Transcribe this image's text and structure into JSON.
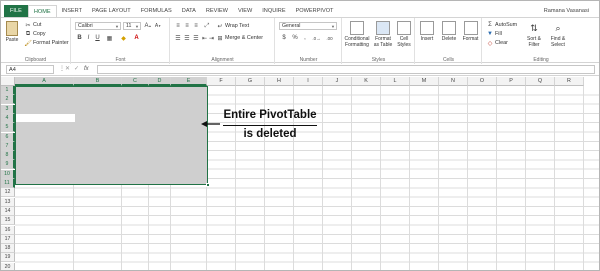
{
  "menu": {
    "tabs": [
      "FILE",
      "HOME",
      "INSERT",
      "PAGE LAYOUT",
      "FORMULAS",
      "DATA",
      "REVIEW",
      "VIEW",
      "INQUIRE",
      "POWERPIVOT"
    ],
    "user": "Ramana Vasanasi"
  },
  "ribbon": {
    "clipboard": {
      "paste": "Paste",
      "cut": "Cut",
      "copy": "Copy",
      "format_painter": "Format Painter",
      "label": "Clipboard"
    },
    "font": {
      "name": "Calibri",
      "size": "11",
      "label": "Font"
    },
    "alignment": {
      "wrap": "Wrap Text",
      "merge": "Merge & Center",
      "label": "Alignment"
    },
    "number": {
      "format": "General",
      "label": "Number"
    },
    "styles": {
      "conditional": "Conditional Formatting",
      "format_as_table": "Format as Table",
      "cell_styles": "Cell Styles",
      "label": "Styles"
    },
    "cells": {
      "insert": "Insert",
      "delete": "Delete",
      "format": "Format",
      "label": "Cells"
    },
    "editing": {
      "autosum": "AutoSum",
      "fill": "Fill",
      "clear": "Clear",
      "sort": "Sort & Filter",
      "find": "Find & Select",
      "label": "Editing"
    }
  },
  "formula_bar": {
    "name_box": "A4",
    "fx": "fx"
  },
  "grid": {
    "columns": [
      "A",
      "B",
      "C",
      "D",
      "E",
      "F",
      "G",
      "H",
      "I",
      "J",
      "K",
      "L",
      "M",
      "N",
      "O",
      "P",
      "Q",
      "R"
    ],
    "selected_columns": [
      "A",
      "B",
      "C",
      "D",
      "E"
    ],
    "rows": [
      "1",
      "2",
      "3",
      "4",
      "5",
      "6",
      "7",
      "8",
      "9",
      "10",
      "11",
      "12",
      "13",
      "14",
      "15",
      "16",
      "17",
      "18",
      "19",
      "20"
    ],
    "selected_rows": [
      "1",
      "2",
      "3",
      "4",
      "5",
      "6",
      "7",
      "8",
      "9",
      "10",
      "11"
    ]
  },
  "annotation": {
    "line1": "Entire PivotTable",
    "line2": "is deleted"
  }
}
